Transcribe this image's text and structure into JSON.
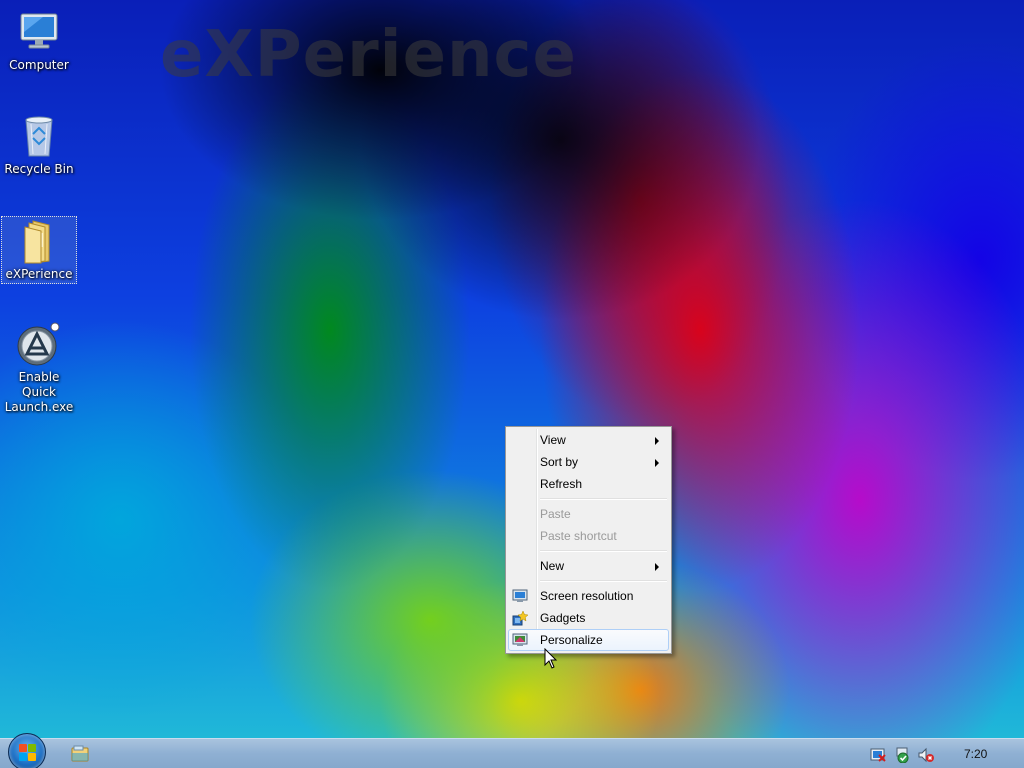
{
  "wallpaper": {
    "watermark_text": "eXPerience"
  },
  "desktop_icons": [
    {
      "label": "Computer",
      "icon": "computer-icon"
    },
    {
      "label": "Recycle Bin",
      "icon": "recycle-bin-icon"
    },
    {
      "label": "eXPerience",
      "icon": "folder-icon",
      "selected": true
    },
    {
      "label": "Enable Quick Launch.exe",
      "icon": "application-icon"
    }
  ],
  "context_menu": {
    "items": [
      {
        "label": "View",
        "submenu": true,
        "enabled": true
      },
      {
        "label": "Sort by",
        "submenu": true,
        "enabled": true
      },
      {
        "label": "Refresh",
        "submenu": false,
        "enabled": true
      },
      {
        "label": "Paste",
        "submenu": false,
        "enabled": false
      },
      {
        "label": "Paste shortcut",
        "submenu": false,
        "enabled": false
      },
      {
        "label": "New",
        "submenu": true,
        "enabled": true
      },
      {
        "label": "Screen resolution",
        "icon": "screen-resolution-icon",
        "enabled": true
      },
      {
        "label": "Gadgets",
        "icon": "gadgets-icon",
        "enabled": true
      },
      {
        "label": "Personalize",
        "icon": "personalize-icon",
        "enabled": true,
        "highlighted": true
      }
    ]
  },
  "taskbar": {
    "start_button": "start-orb-icon",
    "pinned": [
      "file-explorer-icon"
    ],
    "tray_icons": [
      "action-center-icon",
      "network-icon",
      "volume-muted-icon"
    ],
    "clock": "7:20"
  },
  "colors": {
    "menu_bg": "#f0f0f0",
    "menu_highlight_border": "#aecff7",
    "taskbar": "#8fb0d3",
    "disabled_text": "#9a9a9a"
  }
}
